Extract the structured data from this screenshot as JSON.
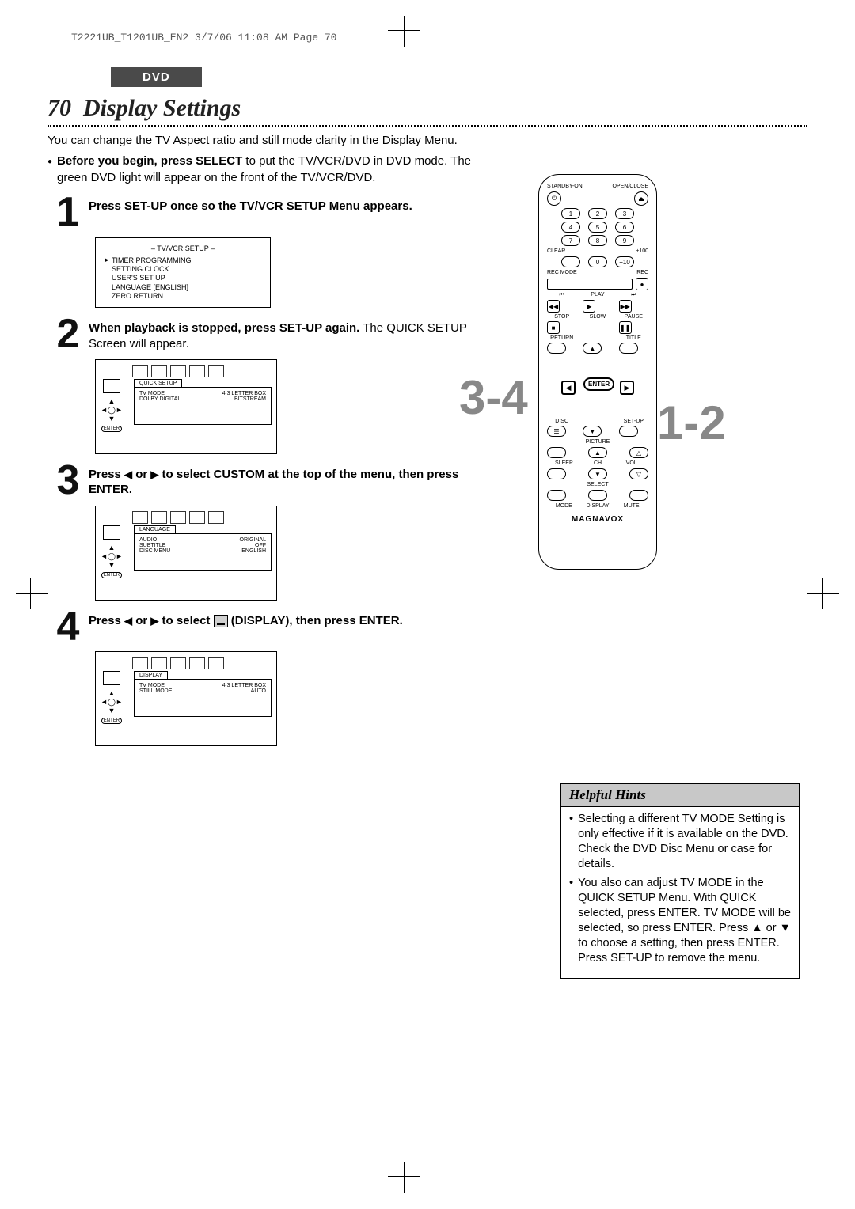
{
  "print_header": "T2221UB_T1201UB_EN2  3/7/06  11:08 AM  Page 70",
  "section_tab": "DVD",
  "page_number": "70",
  "page_title": "Display Settings",
  "intro_p": "You can change the TV Aspect ratio and still mode clarity in the Display Menu.",
  "intro_bullet_bold": "Before you begin, press SELECT",
  "intro_bullet_rest": " to put the TV/VCR/DVD in DVD mode. The green DVD light will appear on the front of the TV/VCR/DVD.",
  "steps": {
    "s1": {
      "num": "1",
      "bold": "Press SET-UP once so the TV/VCR SETUP Menu appears.",
      "rest": ""
    },
    "s2": {
      "num": "2",
      "bold": "When playback is stopped, press SET-UP again.",
      "rest": " The QUICK SETUP Screen will appear."
    },
    "s3": {
      "num": "3",
      "bold_a": "Press ",
      "bold_b": " or ",
      "bold_c": " to select CUSTOM at the top of the menu, then press ENTER.",
      "rest": ""
    },
    "s4": {
      "num": "4",
      "bold_a": "Press ",
      "bold_b": " or ",
      "bold_c": " to select ",
      "bold_d": "  (DISPLAY), then press ENTER.",
      "rest": ""
    }
  },
  "osd1": {
    "title": "– TV/VCR SETUP –",
    "items": [
      "TIMER PROGRAMMING",
      "SETTING CLOCK",
      "USER'S SET UP",
      "LANGUAGE   [ENGLISH]",
      "ZERO RETURN"
    ]
  },
  "osd2": {
    "tab": "QUICK SETUP",
    "r1a": "TV MODE",
    "r1b": "4:3 LETTER BOX",
    "r2a": "DOLBY DIGITAL",
    "r2b": "BITSTREAM"
  },
  "osd3": {
    "tab": "LANGUAGE",
    "r1a": "AUDIO",
    "r1b": "ORIGINAL",
    "r2a": "SUBTITLE",
    "r2b": "OFF",
    "r3a": "DISC MENU",
    "r3b": "ENGLISH"
  },
  "osd4": {
    "tab": "DISPLAY",
    "r1a": "TV MODE",
    "r1b": "4:3 LETTER BOX",
    "r2a": "STILL MODE",
    "r2b": "AUTO"
  },
  "callouts": {
    "c34": "3-4",
    "c12": "1-2"
  },
  "remote": {
    "standby": "STANDBY-ON",
    "openclose": "OPEN/CLOSE",
    "clear": "CLEAR",
    "plus100": "+100",
    "recmode": "REC MODE",
    "rec": "REC",
    "play": "PLAY",
    "stop": "STOP",
    "slow": "SLOW",
    "pause": "PAUSE",
    "return": "RETURN",
    "title": "TITLE",
    "enter": "ENTER",
    "disc": "DISC",
    "setup": "SET-UP",
    "picture": "PICTURE",
    "sleep": "SLEEP",
    "ch": "CH",
    "vol": "VOL",
    "select": "SELECT",
    "mode": "MODE",
    "display": "DISPLAY",
    "mute": "MUTE",
    "brand": "MAGNAVOX",
    "nums": [
      "1",
      "2",
      "3",
      "4",
      "5",
      "6",
      "7",
      "8",
      "9",
      "0"
    ]
  },
  "hints": {
    "title": "Helpful Hints",
    "b1": "Selecting a different TV MODE Setting is only effective if it is available on the DVD. Check the DVD Disc Menu or case for details.",
    "b2": "You also can adjust TV MODE in the QUICK SETUP Menu. With QUICK selected, press ENTER.  TV MODE will be selected, so press ENTER. Press ▲ or ▼ to choose a setting, then press ENTER. Press SET-UP to remove the menu."
  }
}
